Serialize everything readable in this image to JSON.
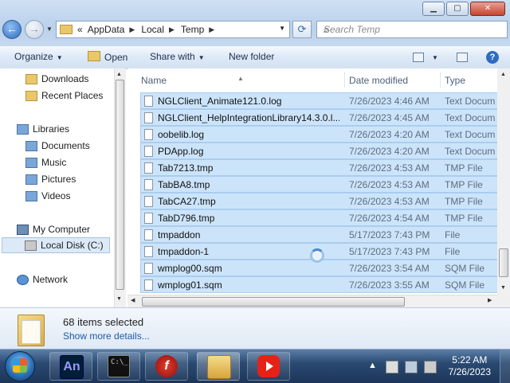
{
  "address": {
    "overflow": "«",
    "crumbs": [
      "AppData",
      "Local",
      "Temp"
    ],
    "search_placeholder": "Search Temp"
  },
  "toolbar": {
    "organize": "Organize",
    "open": "Open",
    "share_with": "Share with",
    "new_folder": "New folder"
  },
  "nav": {
    "downloads": "Downloads",
    "recent_places": "Recent Places",
    "libraries": "Libraries",
    "documents": "Documents",
    "music": "Music",
    "pictures": "Pictures",
    "videos": "Videos",
    "my_computer": "My Computer",
    "local_disk": "Local Disk (C:)",
    "network": "Network"
  },
  "columns": {
    "name": "Name",
    "date_modified": "Date modified",
    "type": "Type"
  },
  "files": [
    {
      "name": "NGLClient_Animate121.0.log",
      "date": "7/26/2023 4:46 AM",
      "type": "Text Docum"
    },
    {
      "name": "NGLClient_HelpIntegrationLibrary14.3.0.l...",
      "date": "7/26/2023 4:45 AM",
      "type": "Text Docum"
    },
    {
      "name": "oobelib.log",
      "date": "7/26/2023 4:20 AM",
      "type": "Text Docum"
    },
    {
      "name": "PDApp.log",
      "date": "7/26/2023 4:20 AM",
      "type": "Text Docum"
    },
    {
      "name": "Tab7213.tmp",
      "date": "7/26/2023 4:53 AM",
      "type": "TMP File"
    },
    {
      "name": "TabBA8.tmp",
      "date": "7/26/2023 4:53 AM",
      "type": "TMP File"
    },
    {
      "name": "TabCA27.tmp",
      "date": "7/26/2023 4:53 AM",
      "type": "TMP File"
    },
    {
      "name": "TabD796.tmp",
      "date": "7/26/2023 4:54 AM",
      "type": "TMP File"
    },
    {
      "name": "tmpaddon",
      "date": "5/17/2023 7:43 PM",
      "type": "File"
    },
    {
      "name": "tmpaddon-1",
      "date": "5/17/2023 7:43 PM",
      "type": "File"
    },
    {
      "name": "wmplog00.sqm",
      "date": "7/26/2023 3:54 AM",
      "type": "SQM File"
    },
    {
      "name": "wmplog01.sqm",
      "date": "7/26/2023 3:55 AM",
      "type": "SQM File"
    }
  ],
  "details": {
    "selected_count": "68 items selected",
    "show_more": "Show more details..."
  },
  "taskbar": {
    "animate_label": "An",
    "clock_time": "5:22 AM",
    "clock_date": "7/26/2023"
  },
  "colors": {
    "selection": "#cce4fa",
    "accent": "#2f6cc0"
  }
}
